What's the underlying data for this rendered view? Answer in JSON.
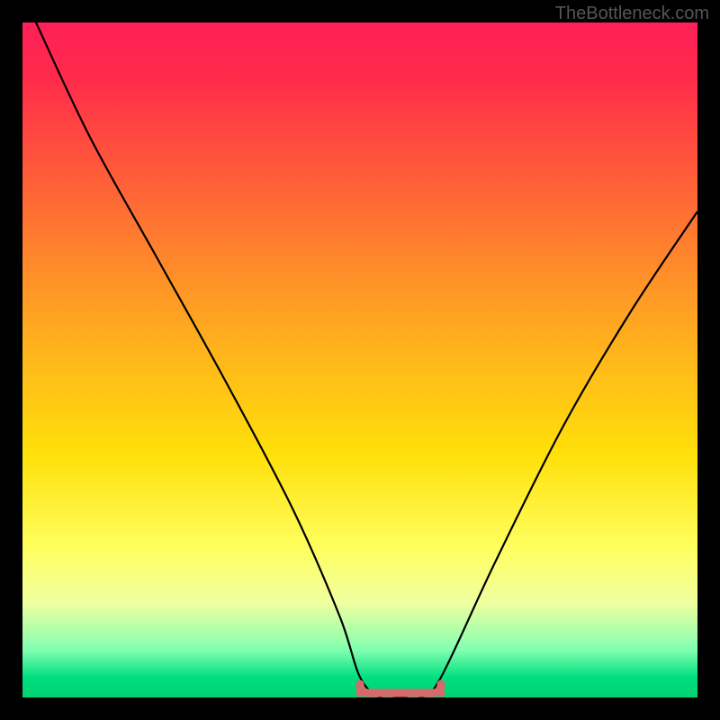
{
  "watermark": "TheBottleneck.com",
  "chart_data": {
    "type": "line",
    "title": "",
    "xlabel": "",
    "ylabel": "",
    "xlim": [
      0,
      100
    ],
    "ylim": [
      0,
      100
    ],
    "series": [
      {
        "name": "bottleneck-curve",
        "x": [
          2,
          10,
          20,
          30,
          40,
          47,
          50,
          53,
          56,
          59,
          62,
          70,
          80,
          90,
          100
        ],
        "values": [
          100,
          83,
          65,
          47,
          28,
          12,
          3,
          0,
          0,
          0,
          3,
          20,
          40,
          57,
          72
        ]
      }
    ],
    "annotations": [
      {
        "name": "valley-marker",
        "x_range": [
          50,
          62
        ],
        "y": 0
      }
    ],
    "gradient_stops": [
      {
        "pos": 0,
        "color": "#ff2058"
      },
      {
        "pos": 8,
        "color": "#ff2a4a"
      },
      {
        "pos": 22,
        "color": "#ff5a3a"
      },
      {
        "pos": 36,
        "color": "#ff8a2a"
      },
      {
        "pos": 50,
        "color": "#ffb81a"
      },
      {
        "pos": 64,
        "color": "#ffe00a"
      },
      {
        "pos": 78,
        "color": "#ffff60"
      },
      {
        "pos": 86,
        "color": "#f0ffa0"
      },
      {
        "pos": 93,
        "color": "#80ffb0"
      },
      {
        "pos": 97,
        "color": "#00e080"
      },
      {
        "pos": 100,
        "color": "#00d070"
      }
    ]
  }
}
